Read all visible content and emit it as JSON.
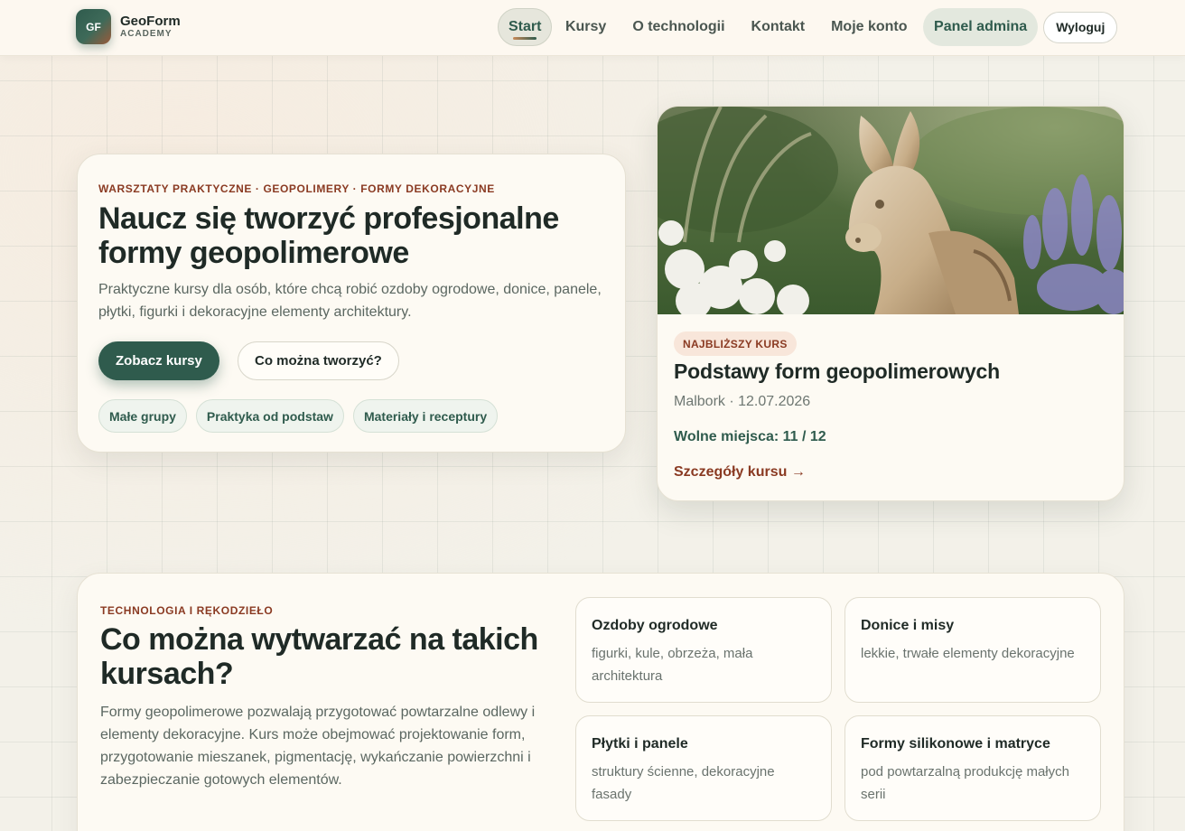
{
  "brand": {
    "badge": "GF",
    "name": "GeoForm",
    "sub": "ACADEMY"
  },
  "nav": {
    "start": "Start",
    "courses": "Kursy",
    "technology": "O technologii",
    "contact": "Kontakt",
    "account": "Moje konto",
    "admin": "Panel admina",
    "logout": "Wyloguj"
  },
  "hero": {
    "eyebrow": "WARSZTATY PRAKTYCZNE · GEOPOLIMERY · FORMY DEKORACYJNE",
    "title": "Naucz się tworzyć profesjonalne formy geopolimerowe",
    "lead": "Praktyczne kursy dla osób, które chcą robić ozdoby ogrodowe, donice, panele, płytki, figurki i dekoracyjne elementy architektury.",
    "primary_button": "Zobacz kursy",
    "secondary_button": "Co można tworzyć?",
    "chips": [
      "Małe grupy",
      "Praktyka od podstaw",
      "Materiały i receptury"
    ]
  },
  "course": {
    "image_icon": "donkey-statue-garden-photo",
    "badge": "NAJBLIŻSZY KURS",
    "title": "Podstawy form geopolimerowych",
    "meta": "Malbork · 12.07.2026",
    "seats": "Wolne miejsca: 11 / 12",
    "details_link": "Szczegóły kursu →"
  },
  "tech": {
    "eyebrow": "TECHNOLOGIA I RĘKODZIEŁO",
    "title": "Co można wytwarzać na takich kursach?",
    "lead": "Formy geopolimerowe pozwalają przygotować powtarzalne odlewy i elementy dekoracyjne. Kurs może obejmować projektowanie form, przygotowanie mieszanek, pigmentację, wykańczanie powierzchni i zabezpieczanie gotowych elementów.",
    "tiles": [
      {
        "title": "Ozdoby ogrodowe",
        "desc": "figurki, kule, obrzeża, mała architektura"
      },
      {
        "title": "Donice i misy",
        "desc": "lekkie, trwałe elementy dekoracyjne"
      },
      {
        "title": "Płytki i panele",
        "desc": "struktury ścienne, dekoracyjne fasady"
      },
      {
        "title": "Formy silikonowe i matryce",
        "desc": "pod powtarzalną produkcję małych serii"
      }
    ]
  },
  "colors": {
    "accent_green": "#2f5b4d",
    "accent_rust": "#8a3a22",
    "card_bg": "#fdfaf3",
    "page_bg": "#f3f1e9"
  }
}
